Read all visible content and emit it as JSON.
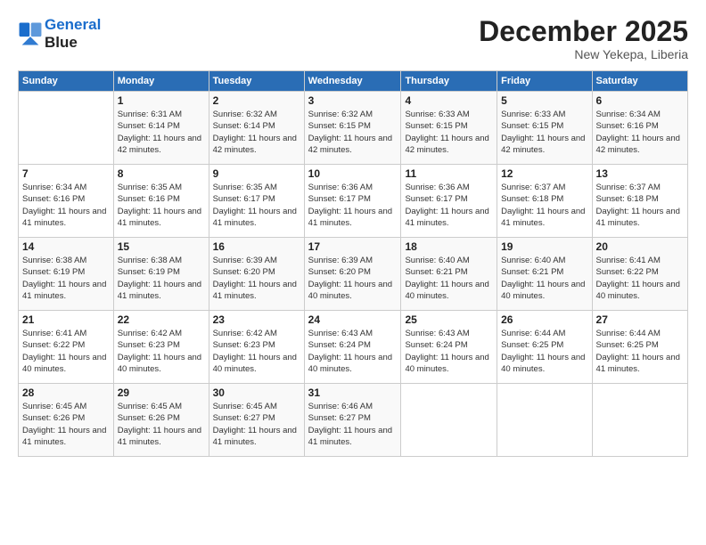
{
  "header": {
    "logo_line1": "General",
    "logo_line2": "Blue",
    "month": "December 2025",
    "location": "New Yekepa, Liberia"
  },
  "weekdays": [
    "Sunday",
    "Monday",
    "Tuesday",
    "Wednesday",
    "Thursday",
    "Friday",
    "Saturday"
  ],
  "weeks": [
    [
      {
        "day": "",
        "sunrise": "",
        "sunset": "",
        "daylight": ""
      },
      {
        "day": "1",
        "sunrise": "Sunrise: 6:31 AM",
        "sunset": "Sunset: 6:14 PM",
        "daylight": "Daylight: 11 hours and 42 minutes."
      },
      {
        "day": "2",
        "sunrise": "Sunrise: 6:32 AM",
        "sunset": "Sunset: 6:14 PM",
        "daylight": "Daylight: 11 hours and 42 minutes."
      },
      {
        "day": "3",
        "sunrise": "Sunrise: 6:32 AM",
        "sunset": "Sunset: 6:15 PM",
        "daylight": "Daylight: 11 hours and 42 minutes."
      },
      {
        "day": "4",
        "sunrise": "Sunrise: 6:33 AM",
        "sunset": "Sunset: 6:15 PM",
        "daylight": "Daylight: 11 hours and 42 minutes."
      },
      {
        "day": "5",
        "sunrise": "Sunrise: 6:33 AM",
        "sunset": "Sunset: 6:15 PM",
        "daylight": "Daylight: 11 hours and 42 minutes."
      },
      {
        "day": "6",
        "sunrise": "Sunrise: 6:34 AM",
        "sunset": "Sunset: 6:16 PM",
        "daylight": "Daylight: 11 hours and 42 minutes."
      }
    ],
    [
      {
        "day": "7",
        "sunrise": "Sunrise: 6:34 AM",
        "sunset": "Sunset: 6:16 PM",
        "daylight": "Daylight: 11 hours and 41 minutes."
      },
      {
        "day": "8",
        "sunrise": "Sunrise: 6:35 AM",
        "sunset": "Sunset: 6:16 PM",
        "daylight": "Daylight: 11 hours and 41 minutes."
      },
      {
        "day": "9",
        "sunrise": "Sunrise: 6:35 AM",
        "sunset": "Sunset: 6:17 PM",
        "daylight": "Daylight: 11 hours and 41 minutes."
      },
      {
        "day": "10",
        "sunrise": "Sunrise: 6:36 AM",
        "sunset": "Sunset: 6:17 PM",
        "daylight": "Daylight: 11 hours and 41 minutes."
      },
      {
        "day": "11",
        "sunrise": "Sunrise: 6:36 AM",
        "sunset": "Sunset: 6:17 PM",
        "daylight": "Daylight: 11 hours and 41 minutes."
      },
      {
        "day": "12",
        "sunrise": "Sunrise: 6:37 AM",
        "sunset": "Sunset: 6:18 PM",
        "daylight": "Daylight: 11 hours and 41 minutes."
      },
      {
        "day": "13",
        "sunrise": "Sunrise: 6:37 AM",
        "sunset": "Sunset: 6:18 PM",
        "daylight": "Daylight: 11 hours and 41 minutes."
      }
    ],
    [
      {
        "day": "14",
        "sunrise": "Sunrise: 6:38 AM",
        "sunset": "Sunset: 6:19 PM",
        "daylight": "Daylight: 11 hours and 41 minutes."
      },
      {
        "day": "15",
        "sunrise": "Sunrise: 6:38 AM",
        "sunset": "Sunset: 6:19 PM",
        "daylight": "Daylight: 11 hours and 41 minutes."
      },
      {
        "day": "16",
        "sunrise": "Sunrise: 6:39 AM",
        "sunset": "Sunset: 6:20 PM",
        "daylight": "Daylight: 11 hours and 41 minutes."
      },
      {
        "day": "17",
        "sunrise": "Sunrise: 6:39 AM",
        "sunset": "Sunset: 6:20 PM",
        "daylight": "Daylight: 11 hours and 40 minutes."
      },
      {
        "day": "18",
        "sunrise": "Sunrise: 6:40 AM",
        "sunset": "Sunset: 6:21 PM",
        "daylight": "Daylight: 11 hours and 40 minutes."
      },
      {
        "day": "19",
        "sunrise": "Sunrise: 6:40 AM",
        "sunset": "Sunset: 6:21 PM",
        "daylight": "Daylight: 11 hours and 40 minutes."
      },
      {
        "day": "20",
        "sunrise": "Sunrise: 6:41 AM",
        "sunset": "Sunset: 6:22 PM",
        "daylight": "Daylight: 11 hours and 40 minutes."
      }
    ],
    [
      {
        "day": "21",
        "sunrise": "Sunrise: 6:41 AM",
        "sunset": "Sunset: 6:22 PM",
        "daylight": "Daylight: 11 hours and 40 minutes."
      },
      {
        "day": "22",
        "sunrise": "Sunrise: 6:42 AM",
        "sunset": "Sunset: 6:23 PM",
        "daylight": "Daylight: 11 hours and 40 minutes."
      },
      {
        "day": "23",
        "sunrise": "Sunrise: 6:42 AM",
        "sunset": "Sunset: 6:23 PM",
        "daylight": "Daylight: 11 hours and 40 minutes."
      },
      {
        "day": "24",
        "sunrise": "Sunrise: 6:43 AM",
        "sunset": "Sunset: 6:24 PM",
        "daylight": "Daylight: 11 hours and 40 minutes."
      },
      {
        "day": "25",
        "sunrise": "Sunrise: 6:43 AM",
        "sunset": "Sunset: 6:24 PM",
        "daylight": "Daylight: 11 hours and 40 minutes."
      },
      {
        "day": "26",
        "sunrise": "Sunrise: 6:44 AM",
        "sunset": "Sunset: 6:25 PM",
        "daylight": "Daylight: 11 hours and 40 minutes."
      },
      {
        "day": "27",
        "sunrise": "Sunrise: 6:44 AM",
        "sunset": "Sunset: 6:25 PM",
        "daylight": "Daylight: 11 hours and 41 minutes."
      }
    ],
    [
      {
        "day": "28",
        "sunrise": "Sunrise: 6:45 AM",
        "sunset": "Sunset: 6:26 PM",
        "daylight": "Daylight: 11 hours and 41 minutes."
      },
      {
        "day": "29",
        "sunrise": "Sunrise: 6:45 AM",
        "sunset": "Sunset: 6:26 PM",
        "daylight": "Daylight: 11 hours and 41 minutes."
      },
      {
        "day": "30",
        "sunrise": "Sunrise: 6:45 AM",
        "sunset": "Sunset: 6:27 PM",
        "daylight": "Daylight: 11 hours and 41 minutes."
      },
      {
        "day": "31",
        "sunrise": "Sunrise: 6:46 AM",
        "sunset": "Sunset: 6:27 PM",
        "daylight": "Daylight: 11 hours and 41 minutes."
      },
      {
        "day": "",
        "sunrise": "",
        "sunset": "",
        "daylight": ""
      },
      {
        "day": "",
        "sunrise": "",
        "sunset": "",
        "daylight": ""
      },
      {
        "day": "",
        "sunrise": "",
        "sunset": "",
        "daylight": ""
      }
    ]
  ]
}
